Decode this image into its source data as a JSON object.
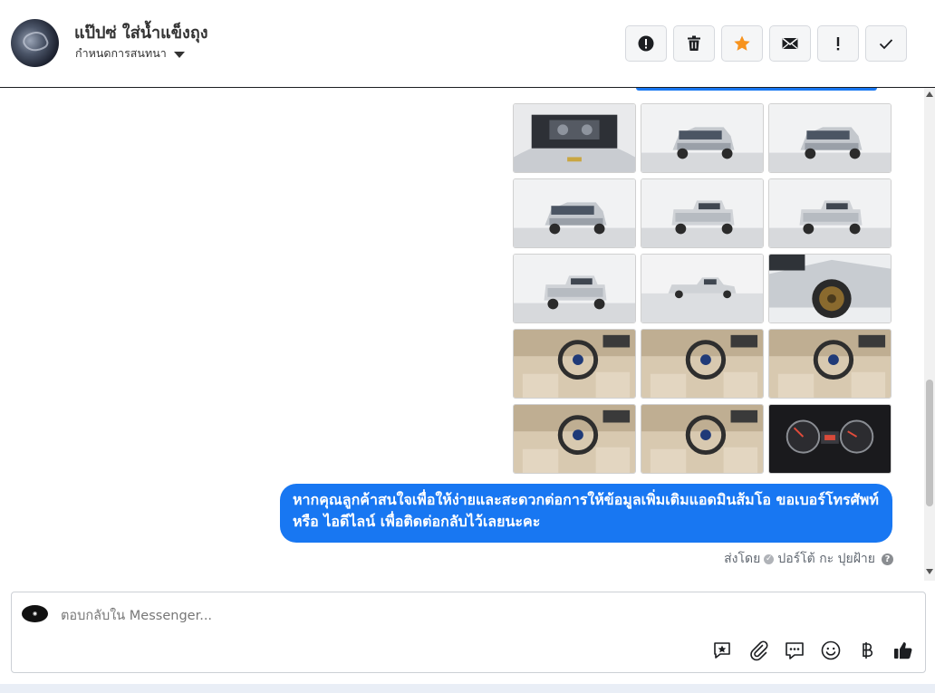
{
  "header": {
    "contact_name": "แป๊ปซ่ ใส่น้ำแข็งถุง",
    "assign_label": "กำหนดการสนทนา",
    "actions": [
      {
        "name": "mark-spam-button",
        "icon": "alert-circle-icon"
      },
      {
        "name": "delete-button",
        "icon": "trash-icon"
      },
      {
        "name": "star-button",
        "icon": "star-icon"
      },
      {
        "name": "mark-unread-button",
        "icon": "envelope-icon"
      },
      {
        "name": "follow-up-button",
        "icon": "exclamation-icon"
      },
      {
        "name": "mark-done-button",
        "icon": "check-icon"
      }
    ]
  },
  "thread": {
    "photos": [
      {
        "label": "engine-bay",
        "scene": "engine"
      },
      {
        "label": "front-three-quarter",
        "scene": "truck-front"
      },
      {
        "label": "front",
        "scene": "truck-front"
      },
      {
        "label": "left-side-front",
        "scene": "truck-front"
      },
      {
        "label": "rear-three-quarter",
        "scene": "truck-rear"
      },
      {
        "label": "rear",
        "scene": "truck-rear"
      },
      {
        "label": "rear-left",
        "scene": "truck-rear"
      },
      {
        "label": "side-far",
        "scene": "truck-side"
      },
      {
        "label": "wheel-closeup",
        "scene": "wheel"
      },
      {
        "label": "door-panel",
        "scene": "interior"
      },
      {
        "label": "dashboard-steering",
        "scene": "interior"
      },
      {
        "label": "steering-wheel",
        "scene": "interior"
      },
      {
        "label": "front-seats",
        "scene": "interior"
      },
      {
        "label": "rear-seat",
        "scene": "interior"
      },
      {
        "label": "gauge-cluster",
        "scene": "gauges"
      }
    ],
    "message_text": "หากคุณลูกค้าสนใจเพื่อให้ง่ายและสะดวกต่อการให้ข้อมูลเพิ่มเติมแอดมินส้มโอ ขอเบอร์โทรศัพท์ หรือ ไอดีไลน์ เพื่อติดต่อกลับไว้เลยนะคะ",
    "sent_by_label": "ส่งโดย",
    "sent_by_name": "ปอร์โต้ กะ ปุยฝ้าย"
  },
  "composer": {
    "placeholder": "ตอบกลับใน Messenger...",
    "tools": [
      "saved-reply-icon",
      "attachment-icon",
      "chat-bubble-icon",
      "emoji-icon",
      "baht-icon",
      "like-icon"
    ]
  },
  "colors": {
    "accent": "#1877f2",
    "star": "#f7931e"
  }
}
